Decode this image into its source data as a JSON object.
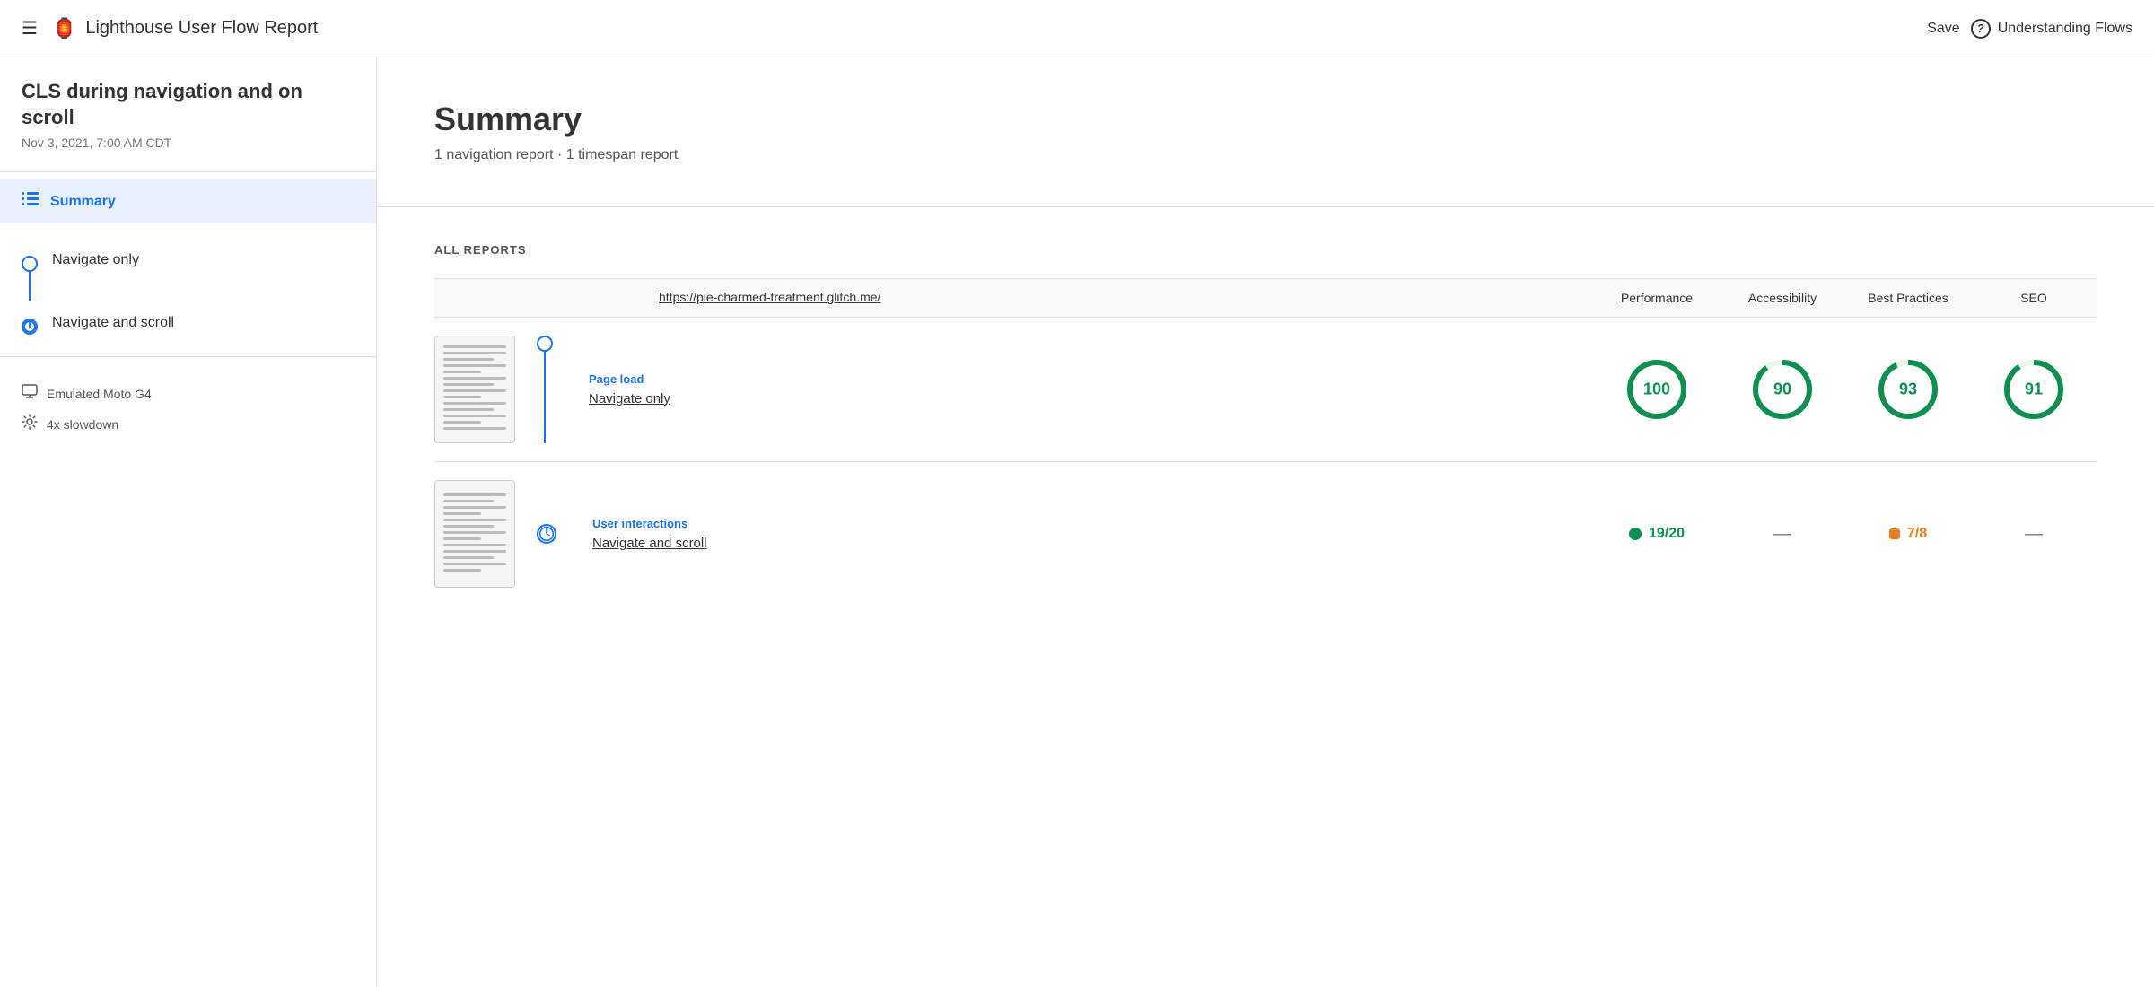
{
  "header": {
    "menu_icon": "☰",
    "logo_icon": "🏮",
    "title": "Lighthouse User Flow Report",
    "save_label": "Save",
    "help_icon": "?",
    "understanding_flows": "Understanding Flows"
  },
  "sidebar": {
    "report_title": "CLS during navigation and on scroll",
    "report_date": "Nov 3, 2021, 7:00 AM CDT",
    "summary_label": "Summary",
    "nav_items": [
      {
        "label": "Navigate only",
        "type": "circle"
      },
      {
        "label": "Navigate and scroll",
        "type": "clock"
      }
    ],
    "device_items": [
      {
        "icon": "🖥",
        "label": "Emulated Moto G4"
      },
      {
        "icon": "⚙",
        "label": "4x slowdown"
      }
    ]
  },
  "summary": {
    "title": "Summary",
    "subtitle": "1 navigation report · 1 timespan report"
  },
  "reports": {
    "section_label": "ALL REPORTS",
    "header": {
      "url": "https://pie-charmed-treatment.glitch.me/",
      "col1": "Performance",
      "col2": "Accessibility",
      "col3": "Best Practices",
      "col4": "SEO"
    },
    "rows": [
      {
        "type_label": "Page load",
        "name": "Navigate only",
        "performance": {
          "value": 100,
          "type": "circle"
        },
        "accessibility": {
          "value": 90,
          "type": "circle"
        },
        "best_practices": {
          "value": 93,
          "type": "circle"
        },
        "seo": {
          "value": 91,
          "type": "circle"
        }
      },
      {
        "type_label": "User interactions",
        "name": "Navigate and scroll",
        "performance": {
          "value": "19/20",
          "type": "dot-green",
          "label": "19/20"
        },
        "accessibility": {
          "value": "—",
          "type": "dash"
        },
        "best_practices": {
          "value": "7/8",
          "type": "dot-orange",
          "label": "7/8"
        },
        "seo": {
          "value": "—",
          "type": "dash"
        }
      }
    ]
  }
}
